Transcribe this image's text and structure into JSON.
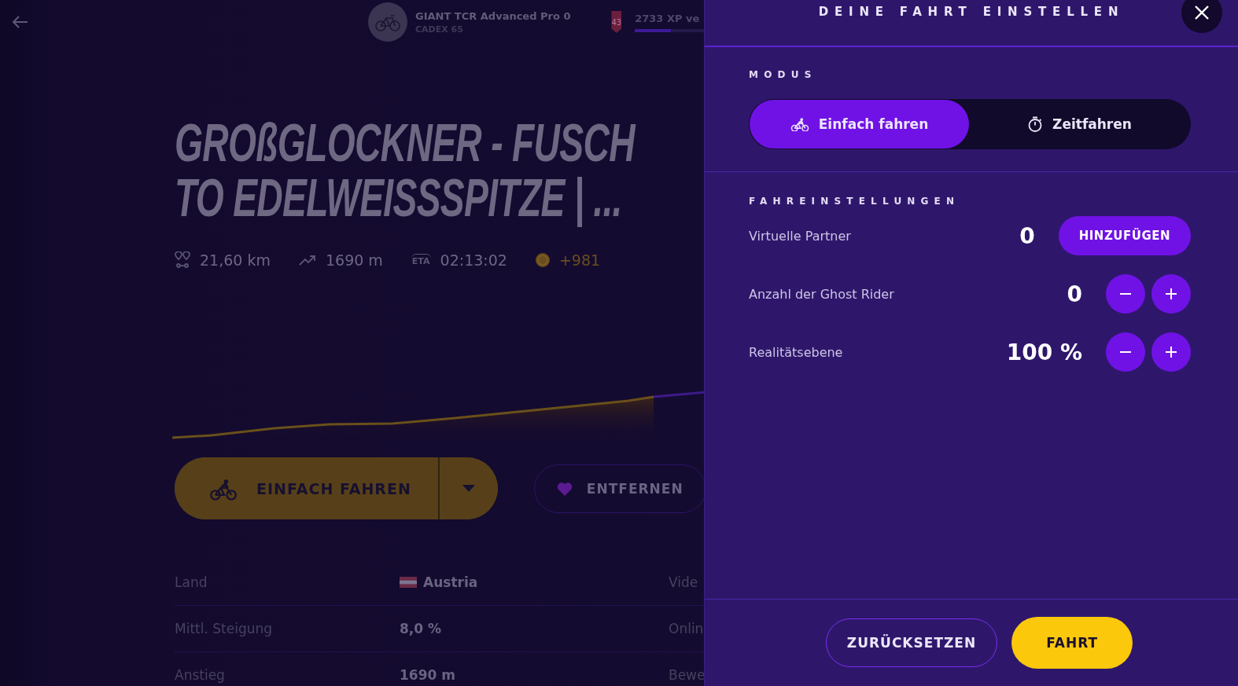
{
  "background": {
    "top_bar": {
      "bike_name": "GIANT TCR Advanced Pro 0",
      "wheels": "CADEX 65",
      "level_badge": "43",
      "xp_text": "2733 XP ve",
      "xp_bar": {
        "level": 0.46
      }
    },
    "title_lines": [
      "GROßGLOCKNER - FUSCH",
      "TO EDELWEISSSPITZE | ..."
    ],
    "stats": [
      {
        "kind": "distance",
        "value": "21,60 km"
      },
      {
        "kind": "elevation",
        "value": "1690 m"
      },
      {
        "kind": "eta",
        "icon_label": "ETA",
        "value": "02:13:02"
      },
      {
        "kind": "coins",
        "value": "+981"
      }
    ],
    "ride_button": {
      "label": "EINFACH FAHREN"
    },
    "favorite_button": {
      "label": "ENTFERNEN"
    },
    "details": [
      {
        "label": "Land",
        "value": "Austria",
        "flag": true,
        "column_3": "Vide"
      },
      {
        "label": "Mittl. Steigung",
        "value": "8,0 %",
        "column_3": "Onlin"
      },
      {
        "label": "Anstieg",
        "value": "1690 m",
        "column_3": "Bewe"
      }
    ]
  },
  "panel": {
    "title": "DEINE FAHRT EINSTELLEN",
    "mode_heading": "MODUS",
    "modes": [
      {
        "kind": "free",
        "label": "Einfach fahren",
        "selected": true
      },
      {
        "kind": "timed",
        "label": "Zeitfahren",
        "selected": false
      }
    ],
    "settings_heading": "FAHREINSTELLUNGEN",
    "settings": [
      {
        "kind": "add",
        "label": "Virtuelle Partner",
        "value": "0",
        "button": "HINZUFÜGEN"
      },
      {
        "kind": "stepper",
        "label": "Anzahl der Ghost Rider",
        "value": "0"
      },
      {
        "kind": "stepper",
        "label": "Realitätsebene",
        "value": "100 %"
      }
    ],
    "buttons": [
      {
        "kind": "secondary",
        "label": "ZURÜCKSETZEN"
      },
      {
        "kind": "primary",
        "label": "FAHRT"
      }
    ]
  }
}
